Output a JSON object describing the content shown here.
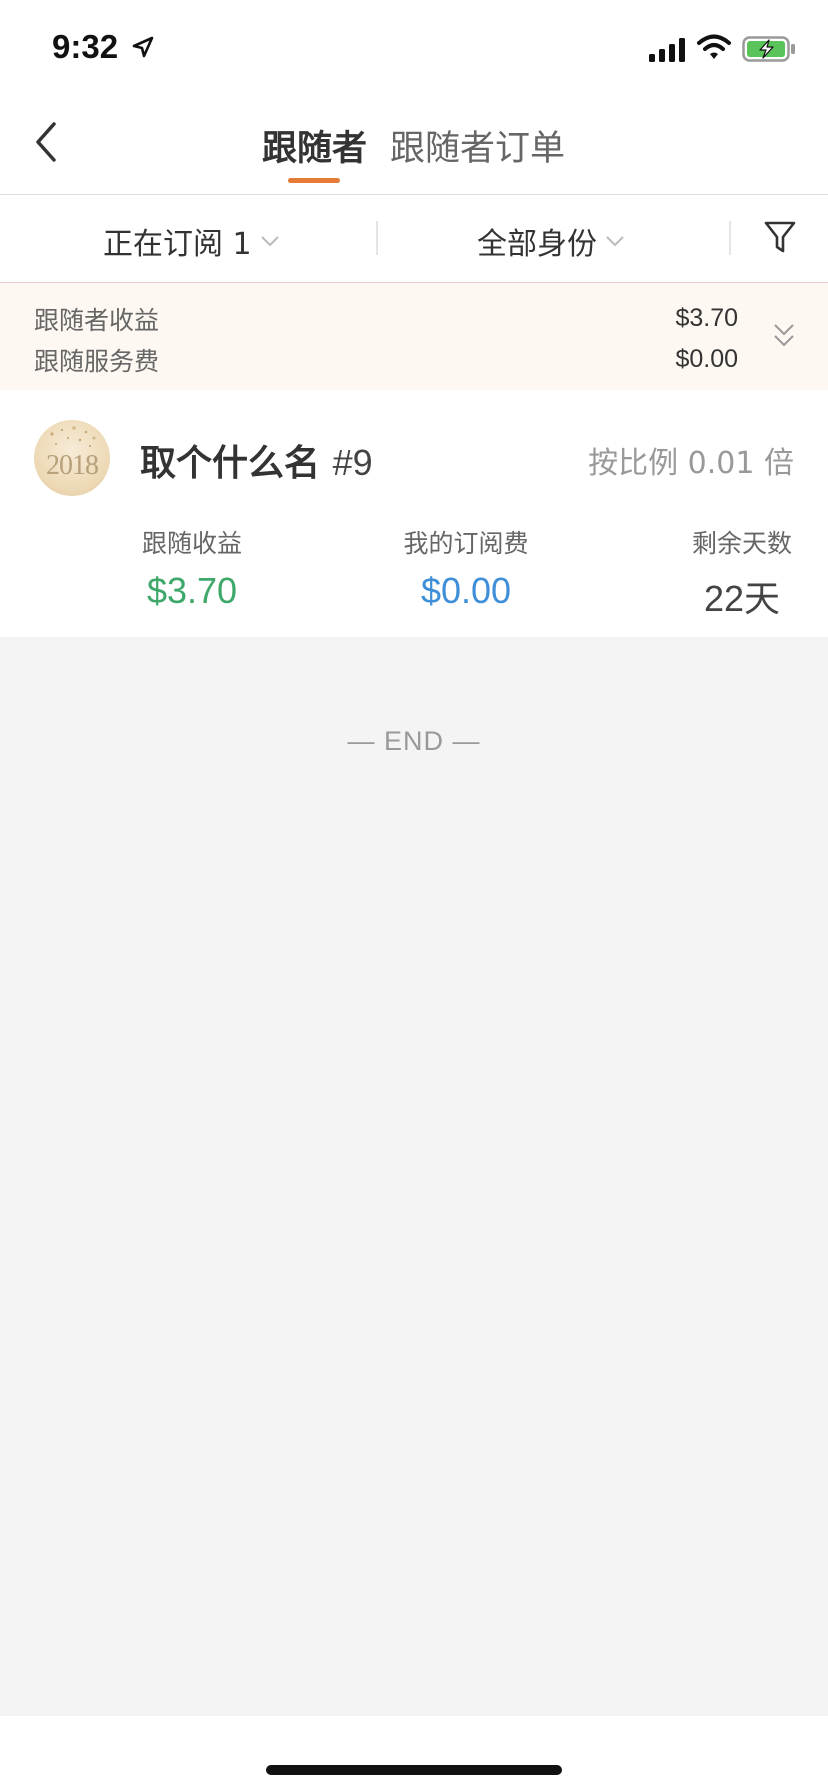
{
  "status_bar": {
    "time": "9:32"
  },
  "nav": {
    "tabs": [
      {
        "label": "跟随者",
        "active": true
      },
      {
        "label": "跟随者订单",
        "active": false
      }
    ]
  },
  "filters": {
    "subscription": "正在订阅 1",
    "identity": "全部身份"
  },
  "summary": {
    "earnings_label": "跟随者收益",
    "earnings_value": "$3.70",
    "fee_label": "跟随服务费",
    "fee_value": "$0.00"
  },
  "follower": {
    "avatar_text": "2018",
    "name": "取个什么名",
    "tag": "#9",
    "ratio": "按比例 0.01 倍",
    "stats": [
      {
        "label": "跟随收益",
        "value": "$3.70",
        "color": "#3ea86a"
      },
      {
        "label": "我的订阅费",
        "value": "$0.00",
        "color": "#3f8fd8"
      },
      {
        "label": "剩余天数",
        "value": "22天",
        "color": "#444444"
      }
    ]
  },
  "end_marker": "— END —",
  "colors": {
    "accent": "#e57b37",
    "summary_bg": "#fdf8f1",
    "profit_green": "#3ea86a",
    "fee_blue": "#3f8fd8"
  }
}
